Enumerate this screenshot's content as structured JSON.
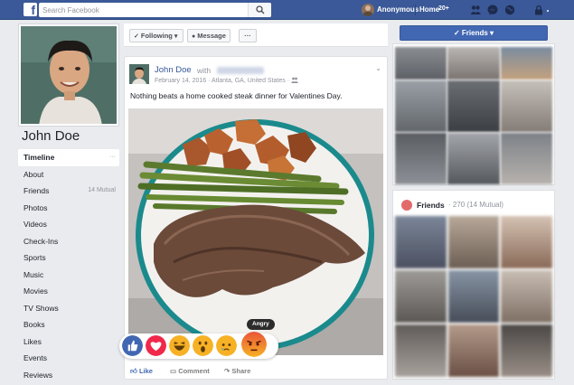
{
  "topbar": {
    "logo": "f",
    "search_placeholder": "Search Facebook",
    "user_name": "Anonymous",
    "home_label": "Home",
    "home_badge": "20+",
    "icons": [
      "friend-requests-icon",
      "messenger-icon",
      "globe-icon",
      "lock-icon"
    ]
  },
  "profile": {
    "name": "John Doe",
    "nav": [
      {
        "label": "Timeline",
        "extra": "···",
        "active": true
      },
      {
        "label": "About"
      },
      {
        "label": "Friends",
        "extra": "14 Mutual"
      },
      {
        "label": "Photos"
      },
      {
        "label": "Videos"
      },
      {
        "label": "Check-Ins"
      },
      {
        "label": "Sports"
      },
      {
        "label": "Music"
      },
      {
        "label": "Movies"
      },
      {
        "label": "TV Shows"
      },
      {
        "label": "Books"
      },
      {
        "label": "Likes"
      },
      {
        "label": "Events"
      },
      {
        "label": "Reviews"
      }
    ]
  },
  "actions": {
    "following": "Following",
    "message": "Message",
    "more": "···"
  },
  "post": {
    "author": "John Doe",
    "with": "with",
    "date": "February 14, 2016",
    "location": "Atlanta, GA, United States",
    "text": "Nothing beats a home cooked steak dinner for Valentines Day.",
    "reaction_tooltip": "Angry",
    "reactions": [
      "like-reaction-icon",
      "love-reaction-icon",
      "haha-reaction-icon",
      "wow-reaction-icon",
      "sad-reaction-icon",
      "angry-reaction-icon"
    ],
    "like_label": "Like",
    "comment_label": "Comment",
    "share_label": "Share"
  },
  "sidebar": {
    "friends_button": "Friends",
    "friends_title": "Friends",
    "friends_count": "· 270 (14 Mutual)"
  },
  "colors": {
    "brand": "#3b5998",
    "button_blue": "#4267b2",
    "link": "#365899",
    "background": "#e9ebee"
  }
}
